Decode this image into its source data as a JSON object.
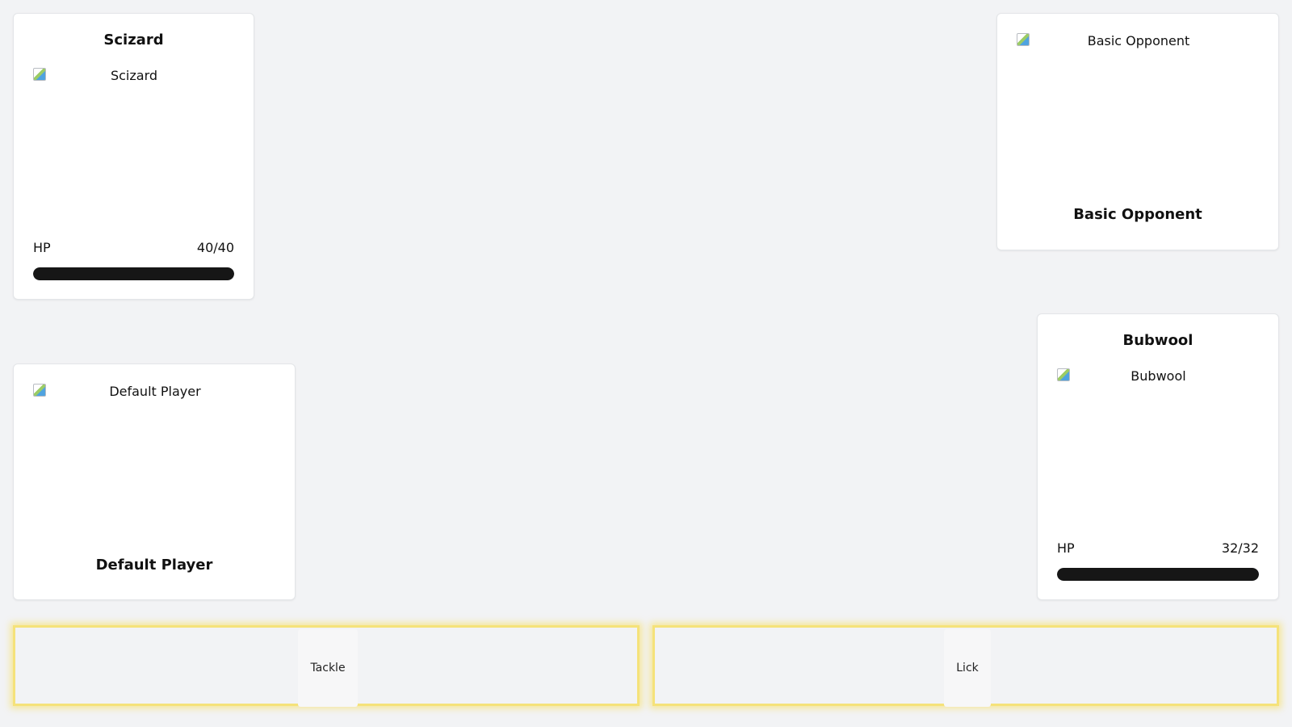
{
  "player_pokemon": {
    "name": "Scizard",
    "image_alt": "Scizard",
    "hp_label": "HP",
    "hp_text": "40/40",
    "hp_fraction": 1.0
  },
  "opponent_trainer": {
    "name": "Basic Opponent",
    "image_alt": "Basic Opponent"
  },
  "player_trainer": {
    "name": "Default Player",
    "image_alt": "Default Player"
  },
  "opponent_pokemon": {
    "name": "Bubwool",
    "image_alt": "Bubwool",
    "hp_label": "HP",
    "hp_text": "32/32",
    "hp_fraction": 1.0
  },
  "moves": [
    {
      "label": "Tackle"
    },
    {
      "label": "Lick"
    }
  ],
  "colors": {
    "hp_fill": "#161616",
    "move_glow": "#f5e27a",
    "background": "#f2f3f5"
  }
}
